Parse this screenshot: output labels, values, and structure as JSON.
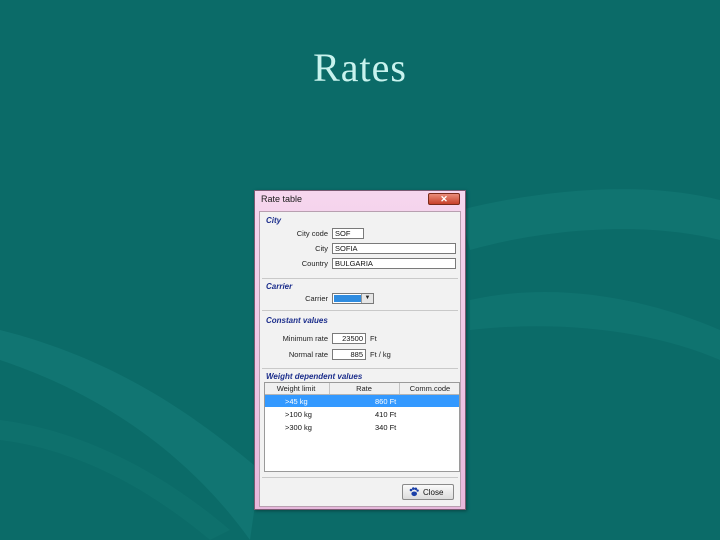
{
  "slide": {
    "title": "Rates"
  },
  "window": {
    "title": "Rate table",
    "close_glyph": "✕"
  },
  "groups": {
    "city": {
      "label": "City",
      "fields": [
        {
          "label": "City code",
          "value": "SOF"
        },
        {
          "label": "City",
          "value": "SOFIA"
        },
        {
          "label": "Country",
          "value": "BULGARIA"
        }
      ]
    },
    "carrier": {
      "label": "Carrier",
      "field_label": "Carrier",
      "value": ""
    },
    "constant": {
      "label": "Constant values",
      "fields": [
        {
          "label": "Minimum rate",
          "value": "23500",
          "unit": "Ft"
        },
        {
          "label": "Normal rate",
          "value": "885",
          "unit": "Ft / kg"
        }
      ]
    },
    "weight": {
      "label": "Weight dependent values",
      "columns": [
        "Weight limit",
        "Rate",
        "Comm.code"
      ],
      "rows": [
        {
          "weight": ">45 kg",
          "rate": "860 Ft",
          "code": ""
        },
        {
          "weight": ">100 kg",
          "rate": "410 Ft",
          "code": ""
        },
        {
          "weight": ">300 kg",
          "rate": "340 Ft",
          "code": ""
        }
      ]
    }
  },
  "footer": {
    "close_label": "Close"
  },
  "icons": {
    "close_button_icon": "paw-icon",
    "combo_arrow": "chevron-down-icon"
  },
  "colors": {
    "background": "#0b6b68",
    "title": "#c8f3ee",
    "group_label": "#1c2e8c",
    "selection": "#3399ff"
  }
}
